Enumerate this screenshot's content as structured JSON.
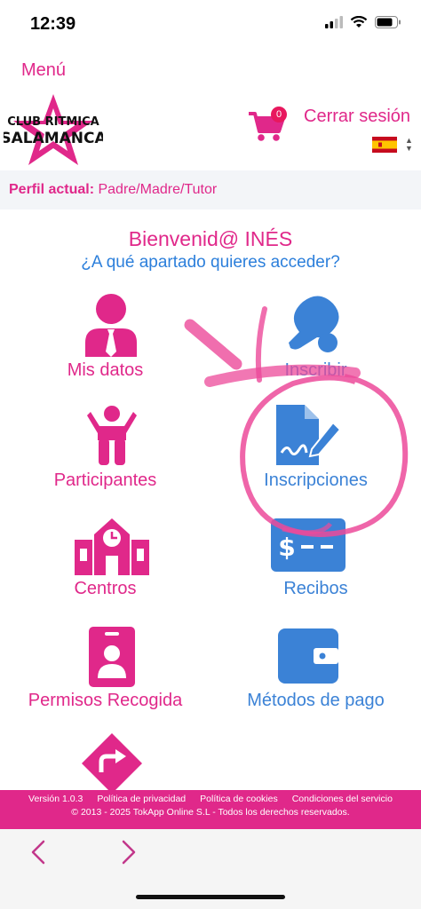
{
  "status": {
    "time": "12:39"
  },
  "header": {
    "menu_label": "Menú",
    "logo_line1": "CLUB RITMICA",
    "logo_line2": "SALAMANCA",
    "cart_count": "0",
    "logout_label": "Cerrar sesión"
  },
  "profile": {
    "label": "Perfil actual:",
    "value": "Padre/Madre/Tutor"
  },
  "welcome": {
    "greeting": "Bienvenid@ INÉS",
    "question": "¿A qué apartado quieres acceder?"
  },
  "tiles": [
    {
      "label": "Mis datos",
      "icon": "user-tie-icon"
    },
    {
      "label": "Inscribir",
      "icon": "table-tennis-icon"
    },
    {
      "label": "Participantes",
      "icon": "child-icon"
    },
    {
      "label": "Inscripciones",
      "icon": "signed-document-icon"
    },
    {
      "label": "Centros",
      "icon": "school-clock-icon"
    },
    {
      "label": "Recibos",
      "icon": "money-check-icon"
    },
    {
      "label": "Permisos Recogida",
      "icon": "id-badge-icon"
    },
    {
      "label": "Métodos de pago",
      "icon": "wallet-icon"
    },
    {
      "label": "",
      "icon": "directions-icon"
    }
  ],
  "footer": {
    "version": "Versión 1.0.3",
    "privacy": "Política de privacidad",
    "cookies": "Política de cookies",
    "terms": "Condiciones del servicio",
    "copyright": "© 2013 - 2025 TokApp Online S.L - Todos los derechos reservados."
  },
  "nav": {
    "back_icon": "chevron-left-icon",
    "forward_icon": "chevron-right-icon"
  },
  "colors": {
    "accent_pink": "#e0288a",
    "accent_blue": "#3b82d6"
  }
}
